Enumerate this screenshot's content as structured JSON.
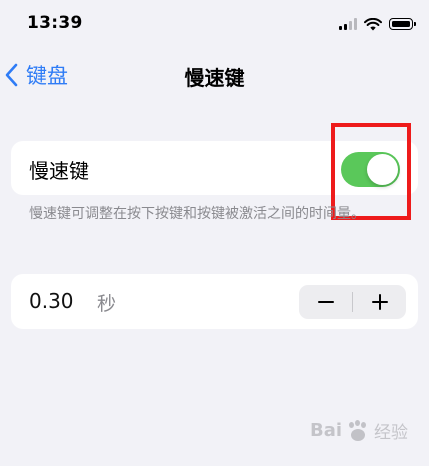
{
  "status_bar": {
    "time": "13:39",
    "icons": [
      "cellular-signal-icon",
      "wifi-icon",
      "battery-icon"
    ]
  },
  "nav": {
    "back_label": "键盘",
    "title": "慢速键"
  },
  "toggle_row": {
    "label": "慢速键",
    "enabled": true,
    "on_color": "#5ac85a"
  },
  "footnote": "慢速键可调整在按下按键和按键被激活之间的时间量。",
  "rate_row": {
    "value": "0.30",
    "unit": "秒",
    "decrement_icon": "minus-icon",
    "increment_icon": "plus-icon"
  },
  "watermark": {
    "brand": "Bai",
    "sub": "经验"
  },
  "colors": {
    "accent": "#2f7cf6",
    "background": "#f2f2f7",
    "highlight": "#ee1b1b"
  }
}
